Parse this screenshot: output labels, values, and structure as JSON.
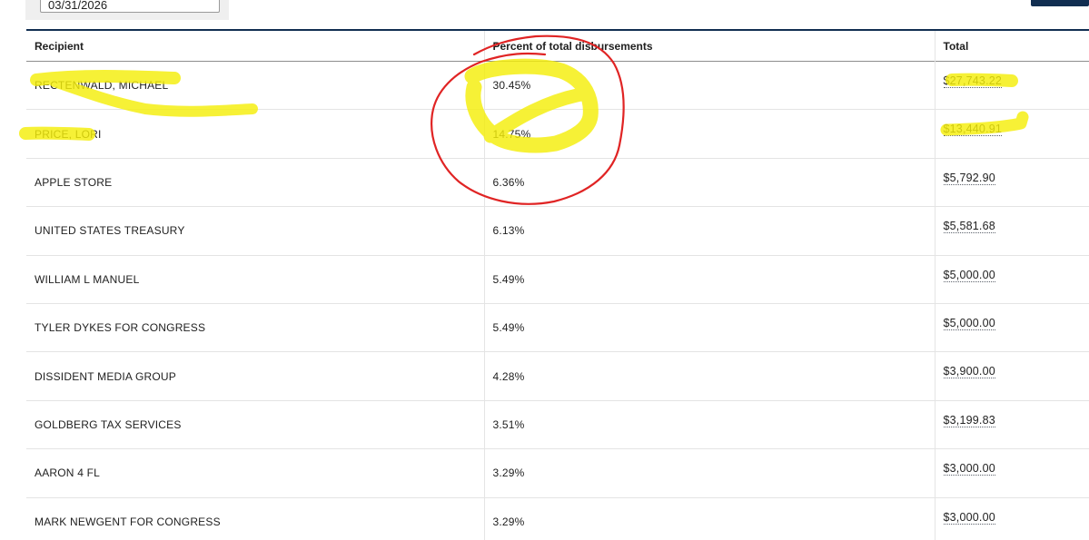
{
  "filter": {
    "date_value": "03/31/2026"
  },
  "table": {
    "headers": {
      "recipient": "Recipient",
      "percent": "Percent of total disbursements",
      "total": "Total"
    },
    "rows": [
      {
        "recipient": "RECTENWALD, MICHAEL",
        "percent": "30.45%",
        "total": "$27,743.22"
      },
      {
        "recipient": "PRICE, LORI",
        "percent": "14.75%",
        "total": "$13,440.91"
      },
      {
        "recipient": "APPLE STORE",
        "percent": "6.36%",
        "total": "$5,792.90"
      },
      {
        "recipient": "UNITED STATES TREASURY",
        "percent": "6.13%",
        "total": "$5,581.68"
      },
      {
        "recipient": "WILLIAM L MANUEL",
        "percent": "5.49%",
        "total": "$5,000.00"
      },
      {
        "recipient": "TYLER DYKES FOR CONGRESS",
        "percent": "5.49%",
        "total": "$5,000.00"
      },
      {
        "recipient": "DISSIDENT MEDIA GROUP",
        "percent": "4.28%",
        "total": "$3,900.00"
      },
      {
        "recipient": "GOLDBERG TAX SERVICES",
        "percent": "3.51%",
        "total": "$3,199.83"
      },
      {
        "recipient": "AARON 4 FL",
        "percent": "3.29%",
        "total": "$3,000.00"
      },
      {
        "recipient": "MARK NEWGENT FOR CONGRESS",
        "percent": "3.29%",
        "total": "$3,000.00"
      }
    ]
  },
  "colors": {
    "highlight": "#f5ee0a",
    "circle": "#e02424",
    "header_rule": "#112e51"
  }
}
